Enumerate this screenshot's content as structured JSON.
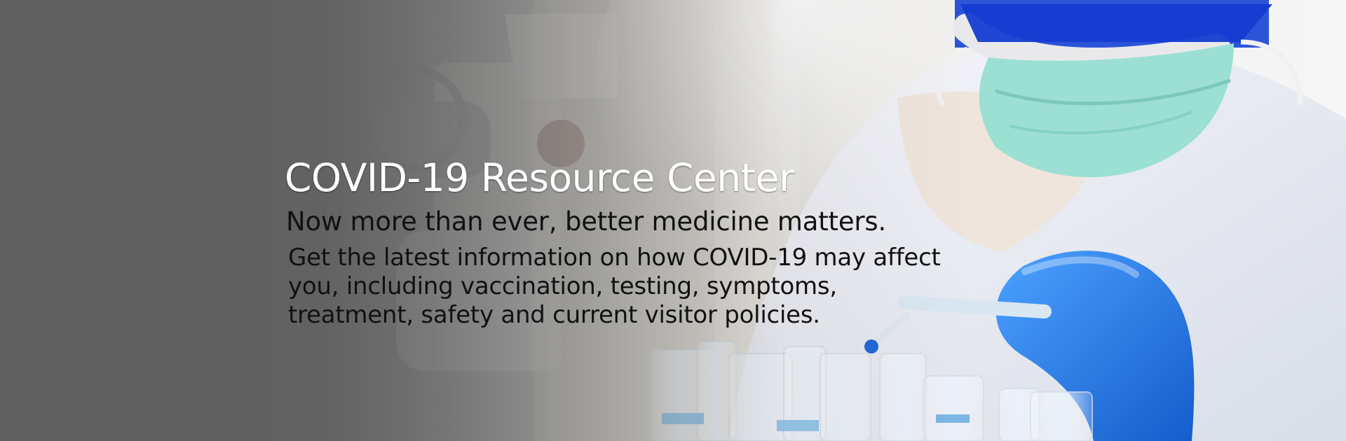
{
  "hero": {
    "title": "COVID-19 Resource Center",
    "subtitle": "Now more than ever, better medicine matters.",
    "body": "Get the latest information on how COVID-19 may affect you, including vaccination, testing, symptoms, treatment, safety and current visitor policies."
  },
  "colors": {
    "left_panel": "#666666",
    "glove_blue": "#1d6fe8",
    "mask_teal": "#8fe0d2",
    "title_text": "#ffffff",
    "body_text": "#111111"
  }
}
